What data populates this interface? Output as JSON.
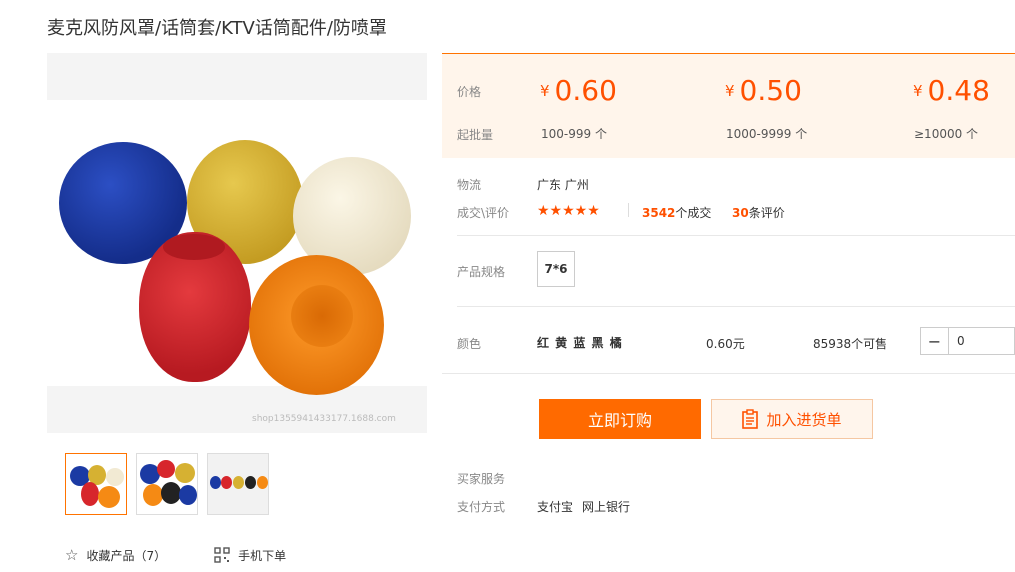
{
  "title": "麦克风防风罩/话筒套/KTV话筒配件/防喷罩",
  "gallery": {
    "watermark": "shop1355941433177.1688.com",
    "ball_colors": [
      "#1b3aa3",
      "#d6b132",
      "#f2ead3",
      "#d7262c",
      "#f58a14"
    ]
  },
  "price_box": {
    "price_label": "价格",
    "moq_label": "起批量",
    "currency": "¥",
    "tiers": [
      {
        "price": "0.60",
        "range": "100-999 个"
      },
      {
        "price": "0.50",
        "range": "1000-9999 个"
      },
      {
        "price": "0.48",
        "range": "≥10000 个"
      }
    ]
  },
  "logistics": {
    "label": "物流",
    "value": "广东 广州"
  },
  "deals": {
    "label": "成交\\评价",
    "stars": "★★★★★",
    "deal_count": "3542",
    "deal_suffix": "个成交",
    "review_count": "30",
    "review_suffix": "条评价"
  },
  "spec": {
    "label": "产品规格",
    "value": "7*6"
  },
  "color_row": {
    "label": "颜色",
    "value": "红 黄 蓝 黑 橘",
    "price": "0.60元",
    "stock": "85938个可售",
    "minus": "−",
    "quantity": "0"
  },
  "buttons": {
    "buy": "立即订购",
    "cart": "加入进货单"
  },
  "services": {
    "label": "买家服务"
  },
  "payment": {
    "label": "支付方式",
    "alipay": "支付宝",
    "bank": "网上银行"
  },
  "bottom": {
    "favorite": "收藏产品（7）",
    "mobile": "手机下单"
  },
  "colors": {
    "accent": "#ff6a00",
    "price": "#ff5000",
    "price_bg": "#fff5eb"
  }
}
